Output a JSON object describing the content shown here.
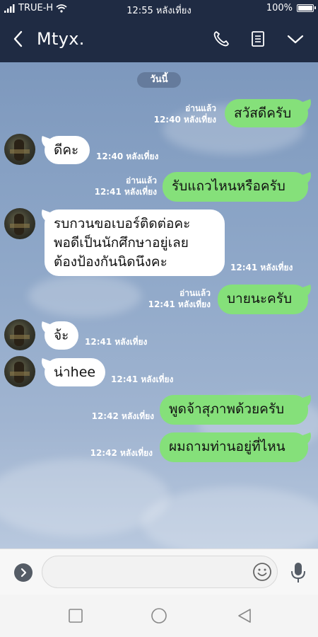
{
  "status_bar": {
    "carrier": "TRUE-H",
    "time": "12:55 หลังเที่ยง",
    "battery": "100%"
  },
  "header": {
    "title": "Mtyx."
  },
  "chat": {
    "date_label": "วันนี้",
    "messages": [
      {
        "id": 1,
        "direction": "out",
        "text": "สวัสดีครับ",
        "read": "อ่านแล้ว",
        "time": "12:40 หลังเที่ยง"
      },
      {
        "id": 2,
        "direction": "in",
        "text": "ดีคะ",
        "time": "12:40 หลังเที่ยง"
      },
      {
        "id": 3,
        "direction": "out",
        "text": "รับแถวไหนหรือครับ",
        "read": "อ่านแล้ว",
        "time": "12:41 หลังเที่ยง"
      },
      {
        "id": 4,
        "direction": "in",
        "lines": [
          "รบกวนขอเบอร์ติดต่อคะ",
          "พอดีเป็นนักศึกษาอยู่เลย",
          "ต้องป้องกันนิดนึงคะ"
        ],
        "time": "12:41 หลังเที่ยง"
      },
      {
        "id": 5,
        "direction": "out",
        "text": "บายนะครับ",
        "read": "อ่านแล้ว",
        "time": "12:41 หลังเที่ยง"
      },
      {
        "id": 6,
        "direction": "in",
        "text": "จ้ะ",
        "time": "12:41 หลังเที่ยง"
      },
      {
        "id": 7,
        "direction": "in",
        "text": "น่าhee",
        "time": "12:41 หลังเที่ยง"
      },
      {
        "id": 8,
        "direction": "out",
        "text": "พูดจ้าสุภาพด้วยครับ",
        "time": "12:42 หลังเที่ยง"
      },
      {
        "id": 9,
        "direction": "out",
        "text": "ผมถามท่านอยู่ที่ไหน",
        "time": "12:42 หลังเที่ยง"
      }
    ]
  },
  "input": {
    "value": "",
    "placeholder": ""
  },
  "colors": {
    "header_bg": "#1f2b43",
    "outgoing_bubble": "#85e07a",
    "incoming_bubble": "#ffffff",
    "chat_bg": "#8aa3c4"
  },
  "icons": {
    "back": "chevron-left-icon",
    "call": "phone-icon",
    "notes": "notes-icon",
    "menu": "chevron-down-icon",
    "expand": "chevron-right-icon",
    "emoji": "emoji-icon",
    "mic": "microphone-icon",
    "nav_recent": "square-icon",
    "nav_home": "circle-icon",
    "nav_back": "triangle-back-icon"
  }
}
